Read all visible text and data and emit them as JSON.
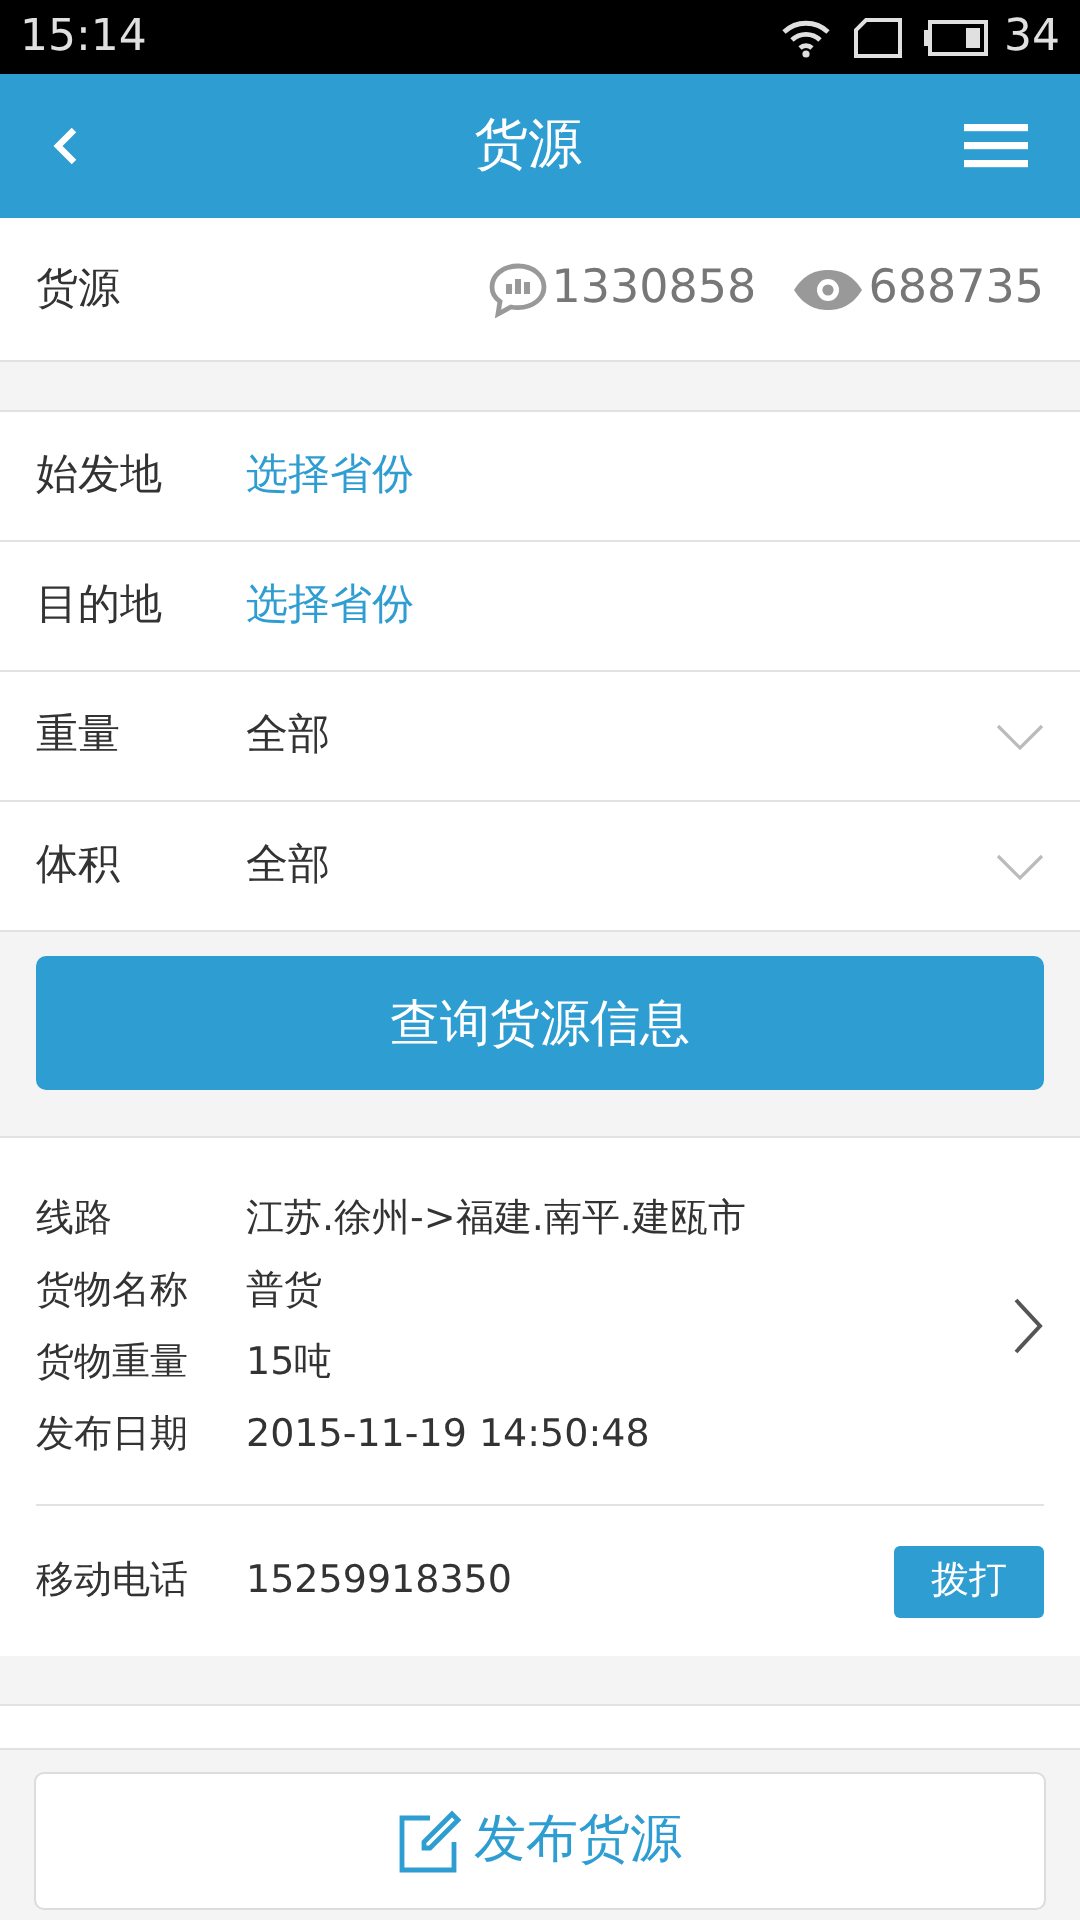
{
  "status_bar": {
    "time": "15:14",
    "battery": "34"
  },
  "header": {
    "title": "货源"
  },
  "stats": {
    "label": "货源",
    "messages": "1330858",
    "views": "688735"
  },
  "filters": [
    {
      "kind": "picker",
      "label": "始发地",
      "value": "选择省份"
    },
    {
      "kind": "picker",
      "label": "目的地",
      "value": "选择省份"
    },
    {
      "kind": "dropdown",
      "label": "重量",
      "value": "全部"
    },
    {
      "kind": "dropdown",
      "label": "体积",
      "value": "全部"
    }
  ],
  "search_button": "查询货源信息",
  "listing": {
    "fields": [
      {
        "label": "线路",
        "value": "江苏.徐州->福建.南平.建瓯市"
      },
      {
        "label": "货物名称",
        "value": "普货"
      },
      {
        "label": "货物重量",
        "value": "15吨"
      },
      {
        "label": "发布日期",
        "value": "2015-11-19 14:50:48"
      }
    ],
    "phone_label": "移动电话",
    "phone": "15259918350",
    "call_button": "拨打"
  },
  "publish_button": "发布货源"
}
